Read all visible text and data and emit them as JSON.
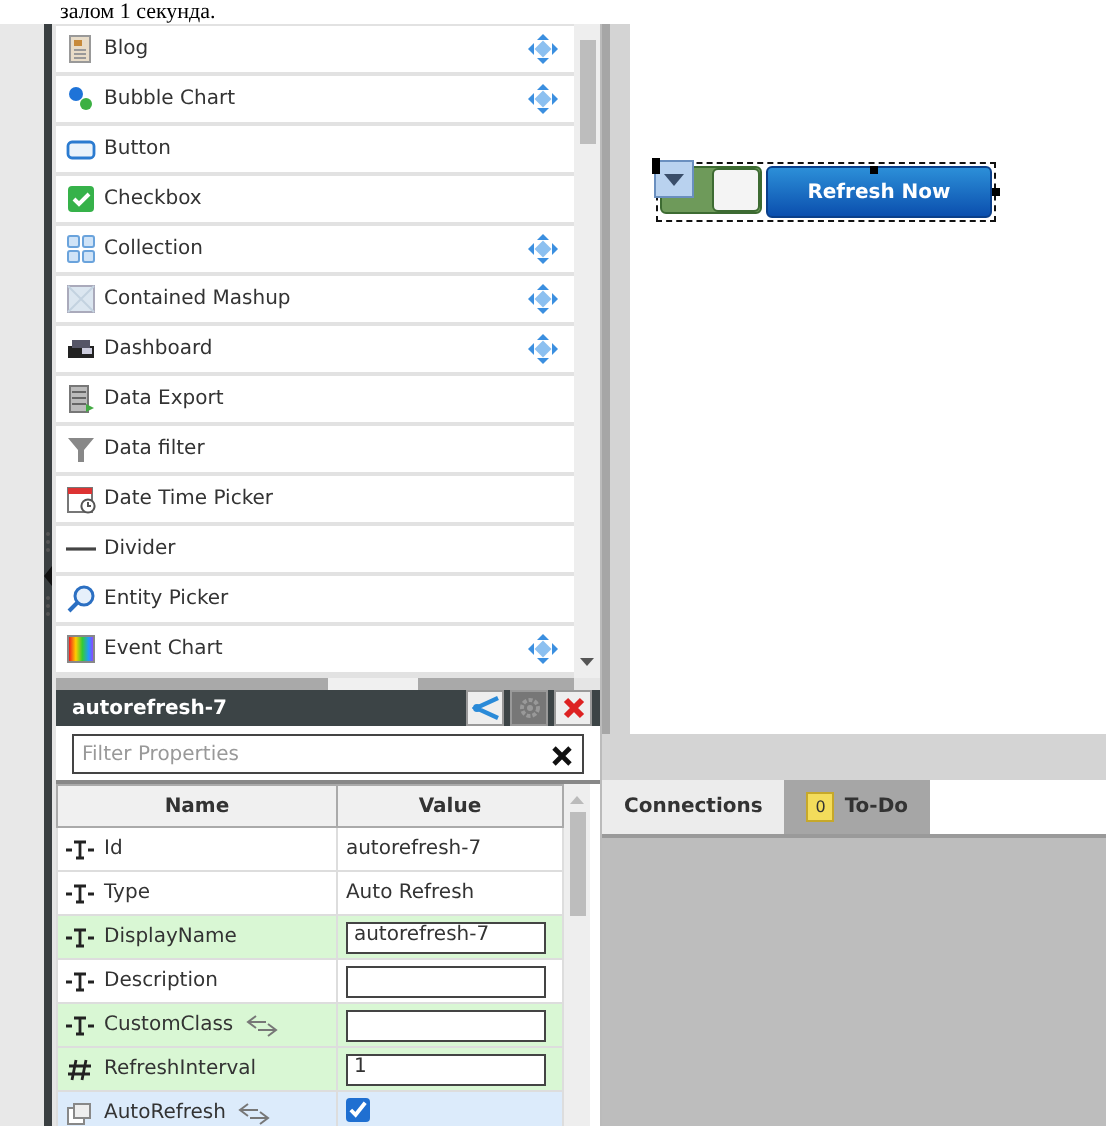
{
  "caption": "залом 1 секунда.",
  "widgets": [
    {
      "label": "Blog",
      "kind": "blog",
      "movable": true
    },
    {
      "label": "Bubble Chart",
      "kind": "bubble",
      "movable": true
    },
    {
      "label": "Button",
      "kind": "button",
      "movable": false
    },
    {
      "label": "Checkbox",
      "kind": "checkbox",
      "movable": false
    },
    {
      "label": "Collection",
      "kind": "collection",
      "movable": true
    },
    {
      "label": "Contained Mashup",
      "kind": "mashup",
      "movable": true
    },
    {
      "label": "Dashboard",
      "kind": "dashboard",
      "movable": true
    },
    {
      "label": "Data Export",
      "kind": "export",
      "movable": false
    },
    {
      "label": "Data filter",
      "kind": "filter",
      "movable": false
    },
    {
      "label": "Date Time Picker",
      "kind": "calendar",
      "movable": false
    },
    {
      "label": "Divider",
      "kind": "divider",
      "movable": false
    },
    {
      "label": "Entity Picker",
      "kind": "search",
      "movable": false
    },
    {
      "label": "Event Chart",
      "kind": "spectrum",
      "movable": true
    }
  ],
  "properties": {
    "title": "autorefresh-7",
    "filter": {
      "placeholder": "Filter Properties"
    },
    "columns": [
      "Name",
      "Value"
    ],
    "rows": [
      {
        "kind": "text",
        "name": "Id",
        "value": "autorefresh-7",
        "editable": false,
        "highlighted": false,
        "bindable": false,
        "selected": false
      },
      {
        "kind": "text",
        "name": "Type",
        "value": "Auto Refresh",
        "editable": false,
        "highlighted": false,
        "bindable": false,
        "selected": false
      },
      {
        "kind": "text",
        "name": "DisplayName",
        "value": "autorefresh-7",
        "editable": true,
        "highlighted": true,
        "bindable": false,
        "selected": false
      },
      {
        "kind": "text",
        "name": "Description",
        "value": "",
        "editable": true,
        "highlighted": false,
        "bindable": false,
        "selected": false
      },
      {
        "kind": "text",
        "name": "CustomClass",
        "value": "",
        "editable": true,
        "highlighted": true,
        "bindable": true,
        "selected": false
      },
      {
        "kind": "number",
        "name": "RefreshInterval",
        "value": "1",
        "editable": true,
        "highlighted": true,
        "bindable": false,
        "selected": false
      },
      {
        "kind": "boolean",
        "name": "AutoRefresh",
        "checked": true,
        "highlighted": false,
        "bindable": true,
        "selected": true
      }
    ]
  },
  "canvas": {
    "toggle_on": true,
    "button": "Refresh Now"
  },
  "tabs": [
    {
      "label": "Connections",
      "selected": true
    },
    {
      "label": "To-Do",
      "selected": false,
      "badge": "0"
    }
  ]
}
